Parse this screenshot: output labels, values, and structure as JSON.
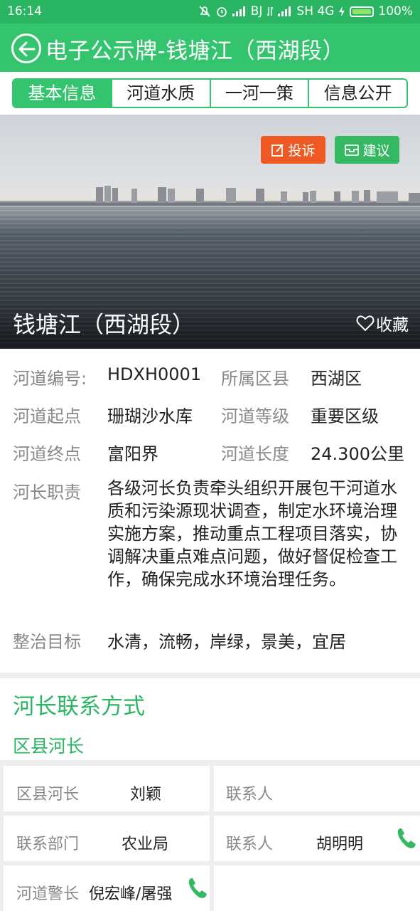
{
  "status_bar": {
    "time": "16:14",
    "carrier1": "BJ",
    "carrier2": "SH 4G",
    "battery": "100%"
  },
  "header": {
    "title": "电子公示牌-钱塘江（西湖段）"
  },
  "tabs": [
    "基本信息",
    "河道水质",
    "一河一策",
    "信息公开"
  ],
  "hero": {
    "complain_label": "投诉",
    "suggest_label": "建议",
    "river_name": "钱塘江（西湖段）",
    "favorite_label": "收藏"
  },
  "info": {
    "code_label": "河道编号:",
    "code_value": "HDXH0001",
    "district_label": "所属区县",
    "district_value": "西湖区",
    "start_label": "河道起点",
    "start_value": "珊瑚沙水库",
    "level_label": "河道等级",
    "level_value": "重要区级",
    "end_label": "河道终点",
    "end_value": "富阳界",
    "length_label": "河道长度",
    "length_value": "24.300公里",
    "duty_label": "河长职责",
    "duty_value": "各级河长负责牵头组织开展包干河道水质和污染源现状调查，制定水环境治理实施方案，推动重点工程项目落实，协调解决重点难点问题，做好督促检查工作，确保完成水环境治理任务。",
    "goal_label": "整治目标",
    "goal_value": "水清，流畅，岸绿，景美，宜居"
  },
  "contact": {
    "title": "河长联系方式",
    "subtitle": "区县河长",
    "rows": [
      {
        "k1": "区县河长",
        "v1": "刘颖",
        "k2": "联系人",
        "v2": ""
      },
      {
        "k1": "联系部门",
        "v1": "农业局",
        "k2": "联系人",
        "v2": "胡明明"
      },
      {
        "k1": "河道警长",
        "v1": "倪宏峰/屠强",
        "k2": "",
        "v2": ""
      }
    ]
  },
  "colors": {
    "primary": "#35c46e",
    "complain": "#ef5a24",
    "suggest": "#35b862"
  }
}
